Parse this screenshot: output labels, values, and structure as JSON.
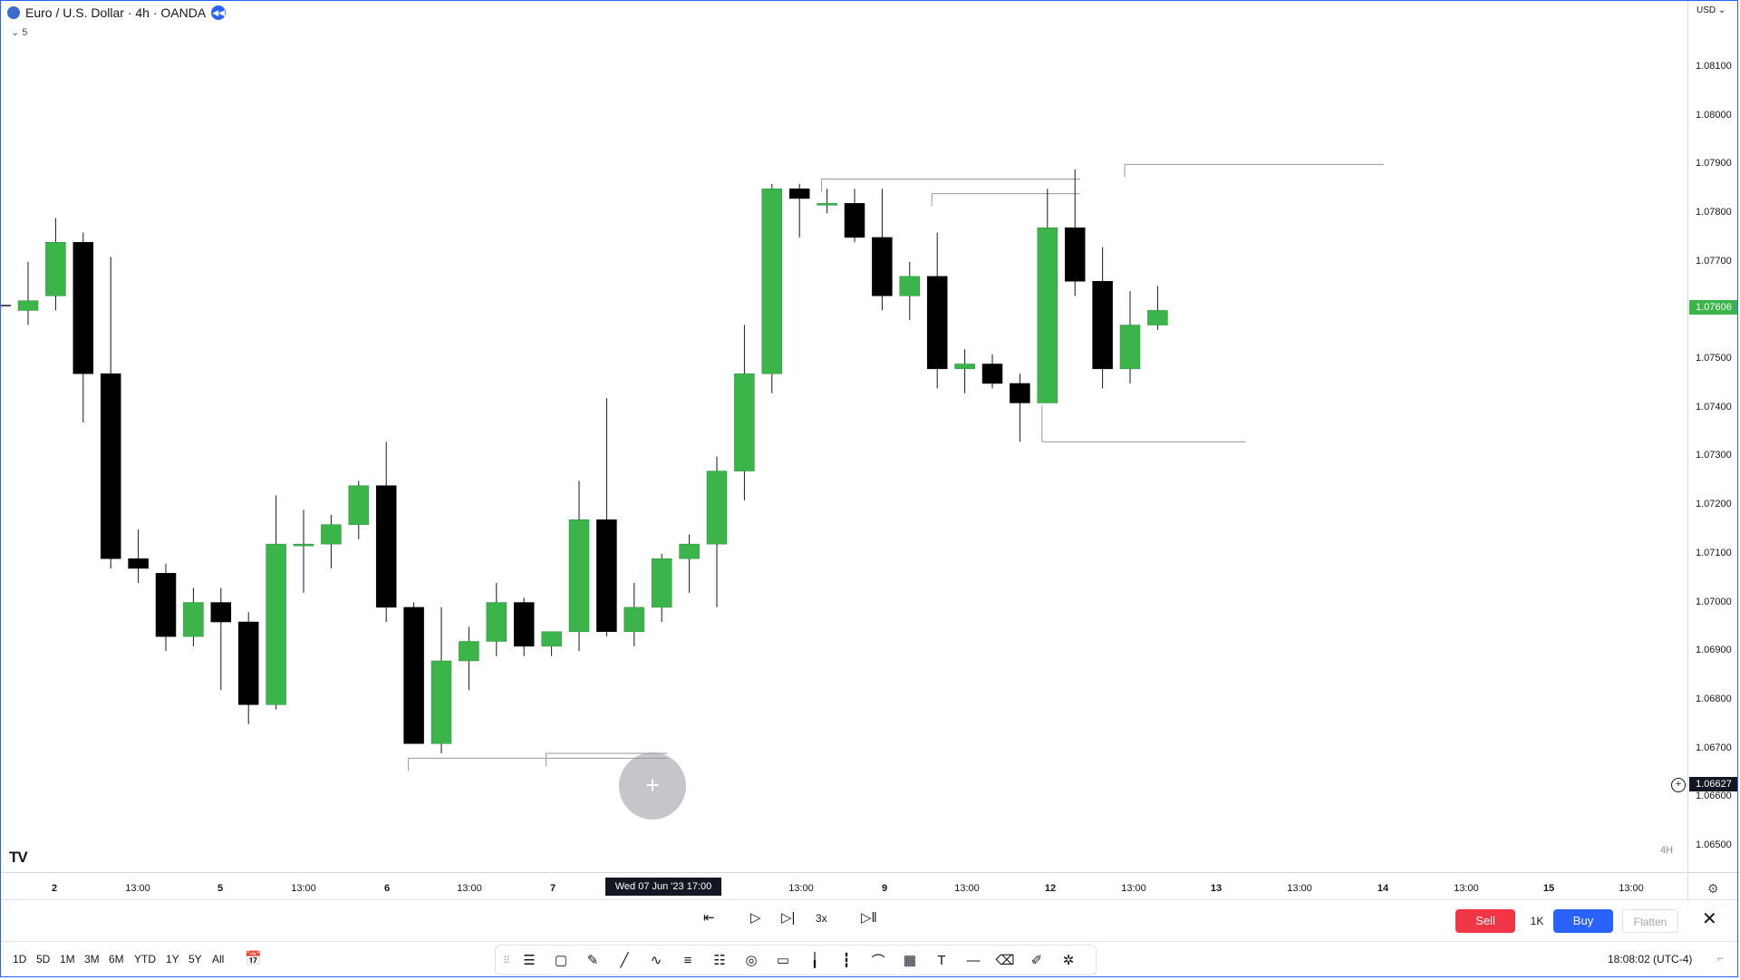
{
  "header": {
    "symbol_title": "Euro / U.S. Dollar · 4h · OANDA",
    "indicator_toggle": "⌄ 5",
    "currency": "USD ⌄"
  },
  "price_axis": {
    "ticks": [
      "1.08100",
      "1.08000",
      "1.07900",
      "1.07800",
      "1.07700",
      "1.07500",
      "1.07400",
      "1.07300",
      "1.07200",
      "1.07100",
      "1.07000",
      "1.06900",
      "1.06800",
      "1.06700",
      "1.06600",
      "1.06500"
    ],
    "current_price": "1.07606",
    "crosshair_price": "1.06627"
  },
  "time_axis": {
    "labels": [
      "2",
      "13:00",
      "5",
      "13:00",
      "6",
      "13:00",
      "7",
      "13:00",
      "9",
      "13:00",
      "12",
      "13:00",
      "13",
      "13:00",
      "14",
      "13:00",
      "15",
      "13:00"
    ],
    "crosshair_time": "Wed 07 Jun '23   17:00"
  },
  "interval_badge": "4H",
  "logo_text": "TV",
  "chart_data": {
    "type": "candlestick",
    "ylim": [
      1.0647,
      1.0822
    ],
    "series": [
      {
        "o": 1.076,
        "h": 1.077,
        "l": 1.0757,
        "c": 1.0762
      },
      {
        "o": 1.0763,
        "h": 1.0779,
        "l": 1.076,
        "c": 1.0774
      },
      {
        "o": 1.0774,
        "h": 1.0776,
        "l": 1.0737,
        "c": 1.0747
      },
      {
        "o": 1.0747,
        "h": 1.0771,
        "l": 1.0707,
        "c": 1.0709
      },
      {
        "o": 1.0709,
        "h": 1.0715,
        "l": 1.0704,
        "c": 1.0707
      },
      {
        "o": 1.0706,
        "h": 1.0708,
        "l": 1.069,
        "c": 1.0693
      },
      {
        "o": 1.0693,
        "h": 1.0703,
        "l": 1.0691,
        "c": 1.07
      },
      {
        "o": 1.07,
        "h": 1.0703,
        "l": 1.0682,
        "c": 1.0696
      },
      {
        "o": 1.0696,
        "h": 1.0698,
        "l": 1.0675,
        "c": 1.0679
      },
      {
        "o": 1.0679,
        "h": 1.0722,
        "l": 1.0678,
        "c": 1.0712
      },
      {
        "o": 1.0712,
        "h": 1.0719,
        "l": 1.0702,
        "c": 1.0712
      },
      {
        "o": 1.0712,
        "h": 1.0718,
        "l": 1.0707,
        "c": 1.0716
      },
      {
        "o": 1.0716,
        "h": 1.0725,
        "l": 1.0713,
        "c": 1.0724
      },
      {
        "o": 1.0724,
        "h": 1.0733,
        "l": 1.0696,
        "c": 1.0699
      },
      {
        "o": 1.0699,
        "h": 1.07,
        "l": 1.0671,
        "c": 1.0671
      },
      {
        "o": 1.0671,
        "h": 1.0699,
        "l": 1.0669,
        "c": 1.0688
      },
      {
        "o": 1.0688,
        "h": 1.0695,
        "l": 1.0682,
        "c": 1.0692
      },
      {
        "o": 1.0692,
        "h": 1.0704,
        "l": 1.0689,
        "c": 1.07
      },
      {
        "o": 1.07,
        "h": 1.0701,
        "l": 1.0689,
        "c": 1.0691
      },
      {
        "o": 1.0691,
        "h": 1.0694,
        "l": 1.0689,
        "c": 1.0694
      },
      {
        "o": 1.0694,
        "h": 1.0725,
        "l": 1.069,
        "c": 1.0717
      },
      {
        "o": 1.0717,
        "h": 1.0742,
        "l": 1.0693,
        "c": 1.0694
      },
      {
        "o": 1.0694,
        "h": 1.0704,
        "l": 1.0691,
        "c": 1.0699
      },
      {
        "o": 1.0699,
        "h": 1.071,
        "l": 1.0696,
        "c": 1.0709
      },
      {
        "o": 1.0709,
        "h": 1.0714,
        "l": 1.0702,
        "c": 1.0712
      },
      {
        "o": 1.0712,
        "h": 1.073,
        "l": 1.0699,
        "c": 1.0727
      },
      {
        "o": 1.0727,
        "h": 1.0757,
        "l": 1.0721,
        "c": 1.0747
      },
      {
        "o": 1.0747,
        "h": 1.0786,
        "l": 1.0743,
        "c": 1.0785
      },
      {
        "o": 1.0785,
        "h": 1.0786,
        "l": 1.0775,
        "c": 1.0783
      },
      {
        "o": 1.0782,
        "h": 1.0785,
        "l": 1.078,
        "c": 1.0782
      },
      {
        "o": 1.0782,
        "h": 1.0785,
        "l": 1.0774,
        "c": 1.0775
      },
      {
        "o": 1.0775,
        "h": 1.0785,
        "l": 1.076,
        "c": 1.0763
      },
      {
        "o": 1.0763,
        "h": 1.077,
        "l": 1.0758,
        "c": 1.0767
      },
      {
        "o": 1.0767,
        "h": 1.0776,
        "l": 1.0744,
        "c": 1.0748
      },
      {
        "o": 1.0748,
        "h": 1.0752,
        "l": 1.0743,
        "c": 1.0749
      },
      {
        "o": 1.0749,
        "h": 1.0751,
        "l": 1.0744,
        "c": 1.0745
      },
      {
        "o": 1.0745,
        "h": 1.0747,
        "l": 1.0733,
        "c": 1.0741
      },
      {
        "o": 1.0741,
        "h": 1.0785,
        "l": 1.0741,
        "c": 1.0777
      },
      {
        "o": 1.0777,
        "h": 1.0789,
        "l": 1.0763,
        "c": 1.0766
      },
      {
        "o": 1.0766,
        "h": 1.0773,
        "l": 1.0744,
        "c": 1.0748
      },
      {
        "o": 1.0748,
        "h": 1.0764,
        "l": 1.0745,
        "c": 1.0757
      },
      {
        "o": 1.0757,
        "h": 1.0765,
        "l": 1.0756,
        "c": 1.076
      }
    ],
    "levels": [
      {
        "x0": 29,
        "x1": 38,
        "y": 1.0787
      },
      {
        "x0": 33,
        "x1": 38,
        "y": 1.0784
      },
      {
        "x0": 40,
        "x1": 49,
        "y": 1.079
      },
      {
        "x0": 37,
        "x1": 44,
        "y": 1.0733
      },
      {
        "x0": 14,
        "x1": 23,
        "y": 1.0668
      },
      {
        "x0": 19,
        "x1": 23,
        "y": 1.0669
      }
    ],
    "up_color": "#3bb44a",
    "down_color": "#000000"
  },
  "replay": {
    "speed": "3x"
  },
  "trade": {
    "sell": "Sell",
    "qty": "1K",
    "buy": "Buy",
    "flatten": "Flatten"
  },
  "ranges": [
    "1D",
    "5D",
    "1M",
    "3M",
    "6M",
    "YTD",
    "1Y",
    "5Y",
    "All"
  ],
  "clock": "18:08:02 (UTC-4)",
  "draw_tools": [
    "lines-icon",
    "rect-icon",
    "brush-icon",
    "trendline-icon",
    "path-icon",
    "channel-icon",
    "fib-icon",
    "circle-icon",
    "callout-icon",
    "vline-icon",
    "bars-icon",
    "curve-icon",
    "grid-icon",
    "text-icon",
    "hline-icon",
    "eraser-icon",
    "pen-icon",
    "settings-icon"
  ]
}
